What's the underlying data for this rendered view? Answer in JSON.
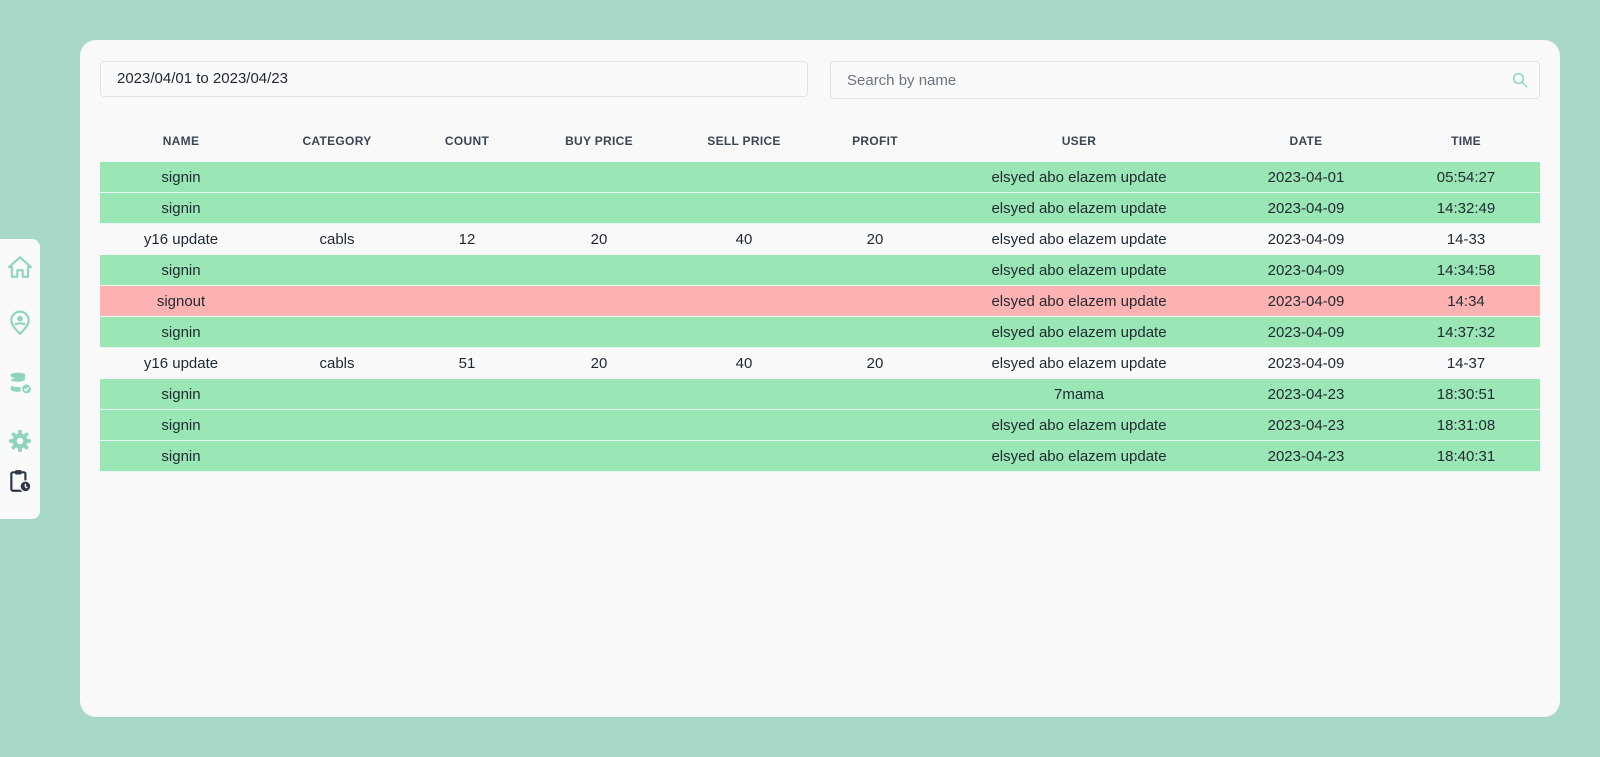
{
  "sidebar": {
    "items": [
      {
        "icon": "home-icon",
        "label": "Home"
      },
      {
        "icon": "user-location-icon",
        "label": "Users"
      },
      {
        "icon": "database-check-icon",
        "label": "Inventory"
      },
      {
        "icon": "gear-icon",
        "label": "Settings"
      },
      {
        "icon": "clipboard-clock-icon",
        "label": "Logs"
      }
    ],
    "colors": {
      "icon": "#8fd5bd",
      "active": "#2d3748"
    }
  },
  "filters": {
    "date_range": "2023/04/01 to 2023/04/23",
    "search_placeholder": "Search by name",
    "search_value": ""
  },
  "table": {
    "columns": [
      "NAME",
      "CATEGORY",
      "COUNT",
      "BUY PRICE",
      "SELL PRICE",
      "PROFIT",
      "USER",
      "DATE",
      "TIME"
    ],
    "rows": [
      {
        "status": "green",
        "cells": [
          "signin",
          "",
          "",
          "",
          "",
          "",
          "elsyed abo elazem update",
          "2023-04-01",
          "05:54:27"
        ]
      },
      {
        "status": "green",
        "cells": [
          "signin",
          "",
          "",
          "",
          "",
          "",
          "elsyed abo elazem update",
          "2023-04-09",
          "14:32:49"
        ]
      },
      {
        "status": "plain",
        "cells": [
          "y16 update",
          "cabls",
          "12",
          "20",
          "40",
          "20",
          "elsyed abo elazem update",
          "2023-04-09",
          "14-33"
        ]
      },
      {
        "status": "green",
        "cells": [
          "signin",
          "",
          "",
          "",
          "",
          "",
          "elsyed abo elazem update",
          "2023-04-09",
          "14:34:58"
        ]
      },
      {
        "status": "red",
        "cells": [
          "signout",
          "",
          "",
          "",
          "",
          "",
          "elsyed abo elazem update",
          "2023-04-09",
          "14:34"
        ]
      },
      {
        "status": "green",
        "cells": [
          "signin",
          "",
          "",
          "",
          "",
          "",
          "elsyed abo elazem update",
          "2023-04-09",
          "14:37:32"
        ]
      },
      {
        "status": "plain",
        "cells": [
          "y16 update",
          "cabls",
          "51",
          "20",
          "40",
          "20",
          "elsyed abo elazem update",
          "2023-04-09",
          "14-37"
        ]
      },
      {
        "status": "green",
        "cells": [
          "signin",
          "",
          "",
          "",
          "",
          "",
          "7mama",
          "2023-04-23",
          "18:30:51"
        ]
      },
      {
        "status": "green",
        "cells": [
          "signin",
          "",
          "",
          "",
          "",
          "",
          "elsyed abo elazem update",
          "2023-04-23",
          "18:31:08"
        ]
      },
      {
        "status": "green",
        "cells": [
          "signin",
          "",
          "",
          "",
          "",
          "",
          "elsyed abo elazem update",
          "2023-04-23",
          "18:40:31"
        ]
      }
    ]
  },
  "colors": {
    "background": "#a8d9c7",
    "panel": "#f9f9f9",
    "signin_row": "#9ae6b4",
    "signout_row": "#feb2b2"
  }
}
